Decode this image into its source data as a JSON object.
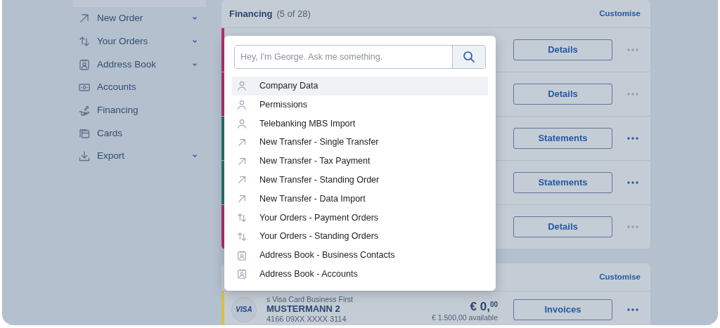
{
  "sidebar": {
    "items": [
      {
        "label": "New Order",
        "kind": "arrow",
        "expandable": true
      },
      {
        "label": "Your Orders",
        "kind": "updown",
        "expandable": true
      },
      {
        "label": "Address Book",
        "kind": "contact",
        "expandable": true
      },
      {
        "label": "Accounts",
        "kind": "banknote",
        "expandable": false
      },
      {
        "label": "Financing",
        "kind": "hand",
        "expandable": false
      },
      {
        "label": "Cards",
        "kind": "cards",
        "expandable": false
      },
      {
        "label": "Export",
        "kind": "download",
        "expandable": true
      }
    ]
  },
  "financing": {
    "title": "Financing",
    "count": "(5 of 28)",
    "customise": "Customise",
    "rows": [
      {
        "color": "#b0306e",
        "button": "Details",
        "menu_enabled": false
      },
      {
        "color": "#b0306e",
        "button": "Details",
        "menu_enabled": false
      },
      {
        "color": "#2a7466",
        "button": "Statements",
        "menu_enabled": true
      },
      {
        "color": "#2a7466",
        "button": "Statements",
        "menu_enabled": true
      },
      {
        "color": "#b0306e",
        "button": "Details",
        "menu_enabled": false
      }
    ]
  },
  "cards": {
    "customise": "Customise",
    "rows": [
      {
        "color": "#d8c04a",
        "logo": "VISA",
        "product": "s Visa Card Business First",
        "name": "MUSTERMANN 2",
        "number": "4166 09XX XXXX 3114",
        "amount": "€ 0,$^{00}$",
        "available": "€ 1.500,00 available",
        "button": "Invoices",
        "menu_enabled": true
      }
    ]
  },
  "search_popup": {
    "placeholder": "Hey, I'm George. Ask me something.",
    "results": [
      {
        "label": "Company Data",
        "kind": "person",
        "selected": true
      },
      {
        "label": "Permissions",
        "kind": "person",
        "selected": false
      },
      {
        "label": "Telebanking MBS Import",
        "kind": "person",
        "selected": false
      },
      {
        "label": "New Transfer - Single Transfer",
        "kind": "arrow",
        "selected": false
      },
      {
        "label": "New Transfer - Tax Payment",
        "kind": "arrow",
        "selected": false
      },
      {
        "label": "New Transfer - Standing Order",
        "kind": "arrow",
        "selected": false
      },
      {
        "label": "New Transfer - Data Import",
        "kind": "arrow",
        "selected": false
      },
      {
        "label": "Your Orders - Payment Orders",
        "kind": "updown",
        "selected": false
      },
      {
        "label": "Your Orders - Standing Orders",
        "kind": "updown",
        "selected": false
      },
      {
        "label": "Address Book - Business Contacts",
        "kind": "contact",
        "selected": false
      },
      {
        "label": "Address Book - Accounts",
        "kind": "contact",
        "selected": false
      }
    ]
  }
}
